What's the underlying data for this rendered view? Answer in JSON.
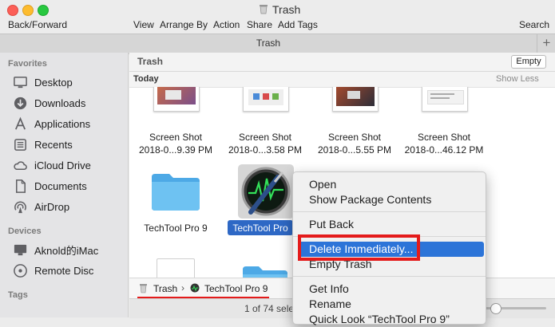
{
  "window": {
    "title": "Trash",
    "tab_title": "Trash"
  },
  "toolbar": {
    "back_forward": "Back/Forward",
    "view": "View",
    "arrange_by": "Arrange By",
    "action": "Action",
    "share": "Share",
    "add_tags": "Add Tags",
    "search": "Search",
    "new_tab": "+"
  },
  "sidebar": {
    "favorites_header": "Favorites",
    "favorites": [
      {
        "label": "Desktop",
        "icon": "desktop-icon"
      },
      {
        "label": "Downloads",
        "icon": "downloads-icon"
      },
      {
        "label": "Applications",
        "icon": "applications-icon"
      },
      {
        "label": "Recents",
        "icon": "recents-icon"
      },
      {
        "label": "iCloud Drive",
        "icon": "cloud-icon"
      },
      {
        "label": "Documents",
        "icon": "documents-icon"
      },
      {
        "label": "AirDrop",
        "icon": "airdrop-icon"
      }
    ],
    "devices_header": "Devices",
    "devices": [
      {
        "label": "Aknold的iMac",
        "icon": "imac-icon"
      },
      {
        "label": "Remote Disc",
        "icon": "disc-icon"
      }
    ],
    "tags_header": "Tags"
  },
  "main": {
    "location_title": "Trash",
    "empty_button": "Empty",
    "section_title": "Today",
    "show_less": "Show Less",
    "screenshots": [
      {
        "name_line1": "Screen Shot",
        "name_line2": "2018-0...9.39 PM"
      },
      {
        "name_line1": "Screen Shot",
        "name_line2": "2018-0...3.58 PM"
      },
      {
        "name_line1": "Screen Shot",
        "name_line2": "2018-0...5.55 PM"
      },
      {
        "name_line1": "Screen Shot",
        "name_line2": "2018-0...46.12 PM"
      }
    ],
    "folder_name": "TechTool Pro 9",
    "app_name": "TechTool Pro"
  },
  "pathbar": {
    "crumbs": [
      "Trash",
      "TechTool Pro 9"
    ],
    "separator": "›"
  },
  "status": {
    "text": "1 of 74 sele"
  },
  "context_menu": {
    "items": [
      {
        "label": "Open"
      },
      {
        "label": "Show Package Contents"
      },
      {
        "label": "Put Back"
      },
      {
        "label": "Delete Immediately..."
      },
      {
        "label": "Empty Trash"
      },
      {
        "label": "Get Info"
      },
      {
        "label": "Rename"
      },
      {
        "label": "Quick Look “TechTool Pro 9”"
      }
    ],
    "highlighted": "Delete Immediately..."
  },
  "colors": {
    "selection_blue": "#2e68c5",
    "menu_highlight": "#2c74d8",
    "annotation_red": "#e41b1b",
    "folder_blue": "#58b5ec",
    "sidebar_bg": "#e4e4e6"
  }
}
